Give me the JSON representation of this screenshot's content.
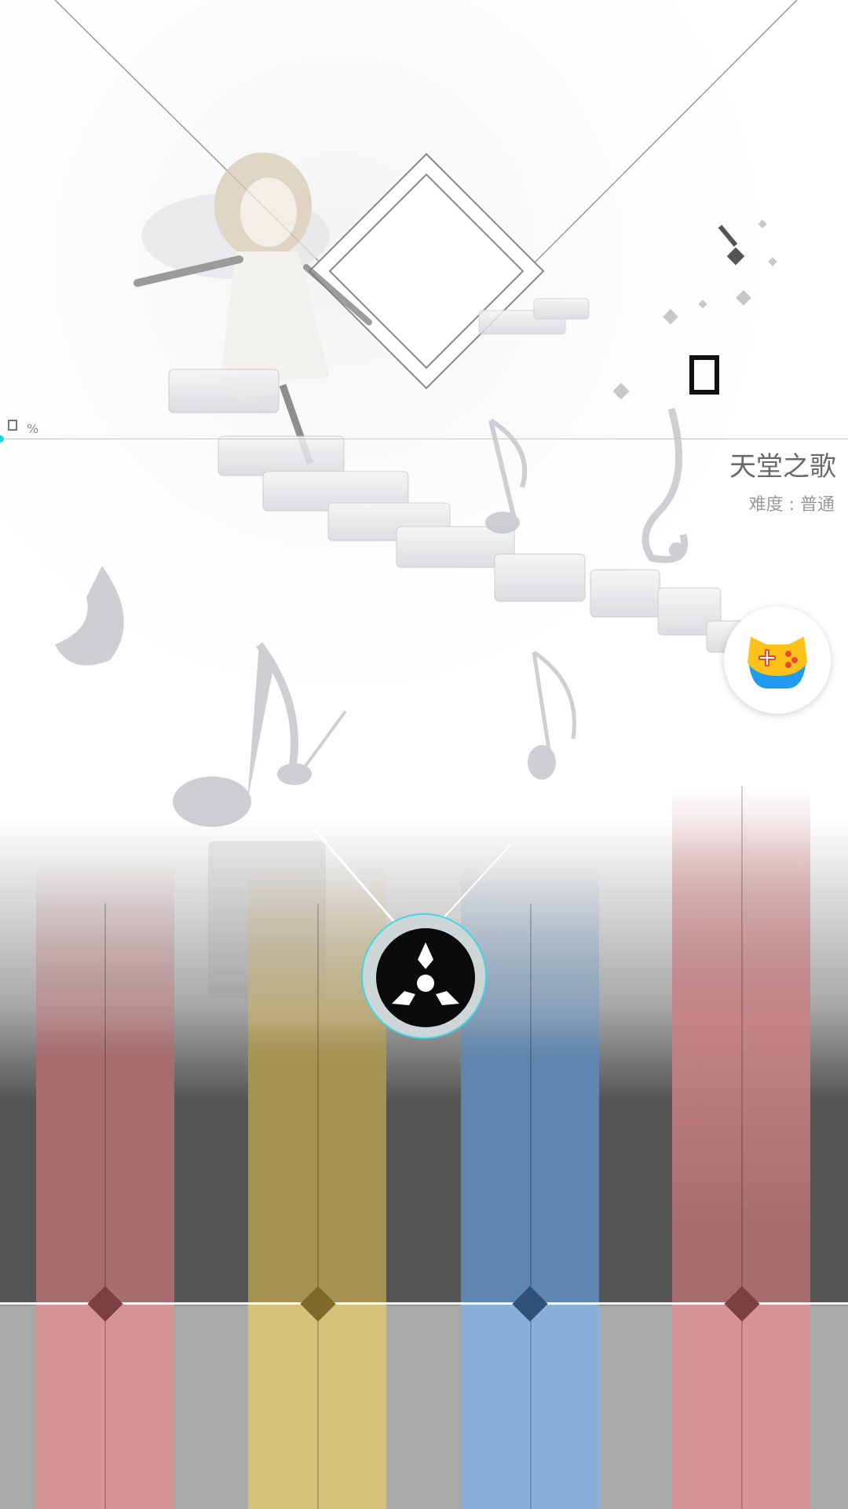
{
  "song": {
    "title": "天堂之歌",
    "difficulty": "难度 : 普通"
  },
  "progress": {
    "percent_symbol": "%",
    "value_fraction": 0
  },
  "combo": {
    "display": ""
  },
  "lanes": [
    {
      "id": "lane-1",
      "color": "#c97a7d"
    },
    {
      "id": "lane-2",
      "color": "#d4b45a"
    },
    {
      "id": "lane-3",
      "color": "#6d9cce"
    },
    {
      "id": "lane-4",
      "color": "#c97a7d"
    }
  ],
  "colors": {
    "accent_cyan": "#3fd8e2",
    "lane_red": "#d99497",
    "lane_gold": "#d6c17a",
    "lane_blue": "#8aafd8",
    "judge_line": "#ffffff"
  },
  "icons": {
    "game_center": "gamepad-icon",
    "menu": "tri-blade-icon"
  }
}
